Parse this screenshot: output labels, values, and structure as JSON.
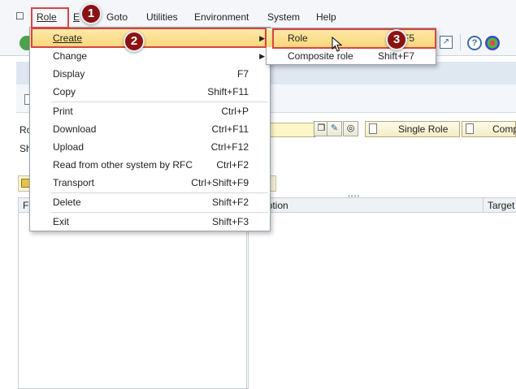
{
  "menubar": {
    "items": [
      {
        "label": "Role",
        "mnemonic": "R"
      },
      {
        "label": "E",
        "mnemonic": "E"
      },
      {
        "label": "Goto",
        "mnemonic": "G"
      },
      {
        "label": "Utilities",
        "mnemonic": "U"
      },
      {
        "label": "Environment",
        "mnemonic": "E"
      },
      {
        "label": "System",
        "mnemonic": "S"
      },
      {
        "label": "Help",
        "mnemonic": "H"
      }
    ]
  },
  "role_menu": {
    "items": [
      {
        "label": "Create",
        "shortcut": ""
      },
      {
        "label": "Change",
        "shortcut": ""
      },
      {
        "label": "Display",
        "shortcut": "F7"
      },
      {
        "label": "Copy",
        "shortcut": "Shift+F11"
      },
      {
        "label": "Print",
        "shortcut": "Ctrl+P"
      },
      {
        "label": "Download",
        "shortcut": "Ctrl+F11"
      },
      {
        "label": "Upload",
        "shortcut": "Ctrl+F12"
      },
      {
        "label": "Read from other system by RFC",
        "shortcut": "Ctrl+F2"
      },
      {
        "label": "Transport",
        "shortcut": "Ctrl+Shift+F9"
      },
      {
        "label": "Delete",
        "shortcut": "Shift+F2"
      },
      {
        "label": "Exit",
        "shortcut": "Shift+F3"
      }
    ]
  },
  "create_submenu": {
    "items": [
      {
        "label": "Role",
        "shortcut": "F5"
      },
      {
        "label": "Composite role",
        "shortcut": "Shift+F7"
      }
    ]
  },
  "form": {
    "role_label": "Ro",
    "sh_label": "Sh",
    "single_role_button": "Single Role",
    "composite_button": "Comp"
  },
  "table": {
    "left_header": "F",
    "description_header": "cription",
    "target_header": "Target"
  },
  "callouts": [
    "1",
    "2",
    "3"
  ],
  "colors": {
    "highlight": "#f9d77a",
    "callout_red": "#d64545",
    "badge": "#8a1212"
  }
}
